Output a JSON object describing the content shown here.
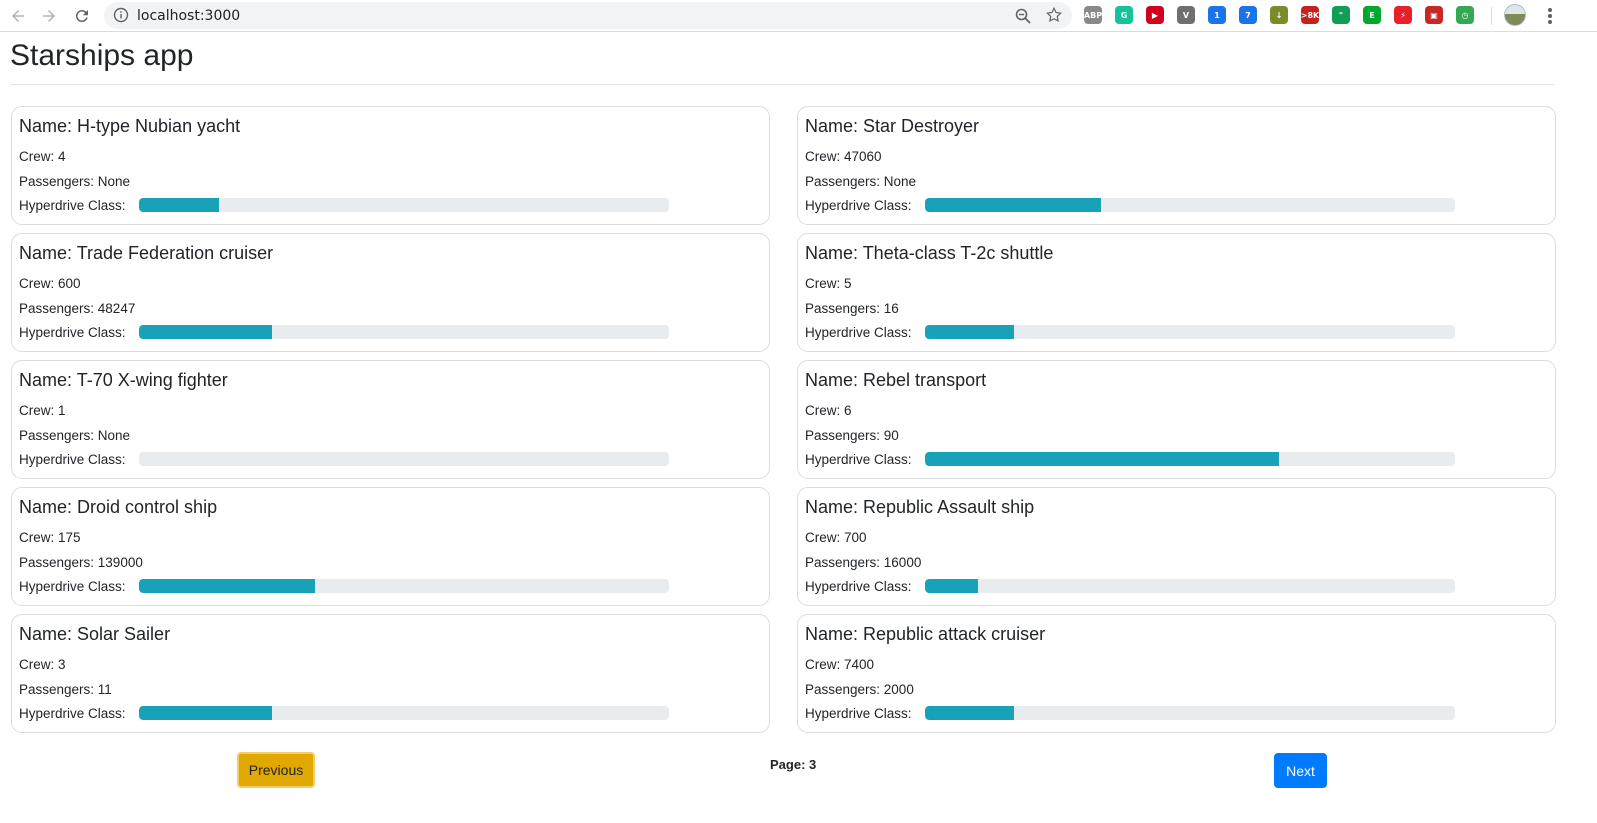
{
  "browser": {
    "url": "localhost:3000",
    "extensions": [
      {
        "icon": "adblock-plus-icon",
        "color": "#8a8a8a",
        "label": "ABP"
      },
      {
        "icon": "grammarly-icon",
        "color": "#15c39a",
        "label": "G"
      },
      {
        "icon": "video-downloader-icon",
        "color": "#d0021b",
        "label": "▶"
      },
      {
        "icon": "vimium-icon",
        "color": "#6f6f6f",
        "label": "V"
      },
      {
        "icon": "calendar-icon",
        "color": "#1a73e8",
        "label": "1"
      },
      {
        "icon": "mail-checker-icon",
        "color": "#1a73e8",
        "label": "7"
      },
      {
        "icon": "download-icon",
        "color": "#7a8b2a",
        "label": "↓"
      },
      {
        "icon": "gmail-notifier-icon",
        "color": "#c5221f",
        "label": ">8K"
      },
      {
        "icon": "hangouts-icon",
        "color": "#0f9d58",
        "label": "\""
      },
      {
        "icon": "evernote-icon",
        "color": "#00a82d",
        "label": "E"
      },
      {
        "icon": "compass-icon",
        "color": "#e8202a",
        "label": "⚡"
      },
      {
        "icon": "photo-icon",
        "color": "#c62828",
        "label": "▣"
      },
      {
        "icon": "timer-icon",
        "color": "#34a853",
        "label": "◷"
      }
    ]
  },
  "page": {
    "title": "Starships app"
  },
  "ships": [
    {
      "name": "Name: H-type Nubian yacht",
      "crew": "Crew: 4",
      "passengers": "Passengers: None",
      "hyperdrive_label": "Hyperdrive Class:",
      "hyperdrive_percent": 15
    },
    {
      "name": "Name: Star Destroyer",
      "crew": "Crew: 47060",
      "passengers": "Passengers: None",
      "hyperdrive_label": "Hyperdrive Class:",
      "hyperdrive_percent": 33.3
    },
    {
      "name": "Name: Trade Federation cruiser",
      "crew": "Crew: 600",
      "passengers": "Passengers: 48247",
      "hyperdrive_label": "Hyperdrive Class:",
      "hyperdrive_percent": 25
    },
    {
      "name": "Name: Theta-class T-2c shuttle",
      "crew": "Crew: 5",
      "passengers": "Passengers: 16",
      "hyperdrive_label": "Hyperdrive Class:",
      "hyperdrive_percent": 16.7
    },
    {
      "name": "Name: T-70 X-wing fighter",
      "crew": "Crew: 1",
      "passengers": "Passengers: None",
      "hyperdrive_label": "Hyperdrive Class:",
      "hyperdrive_percent": 0
    },
    {
      "name": "Name: Rebel transport",
      "crew": "Crew: 6",
      "passengers": "Passengers: 90",
      "hyperdrive_label": "Hyperdrive Class:",
      "hyperdrive_percent": 66.7
    },
    {
      "name": "Name: Droid control ship",
      "crew": "Crew: 175",
      "passengers": "Passengers: 139000",
      "hyperdrive_label": "Hyperdrive Class:",
      "hyperdrive_percent": 33.3
    },
    {
      "name": "Name: Republic Assault ship",
      "crew": "Crew: 700",
      "passengers": "Passengers: 16000",
      "hyperdrive_label": "Hyperdrive Class:",
      "hyperdrive_percent": 10
    },
    {
      "name": "Name: Solar Sailer",
      "crew": "Crew: 3",
      "passengers": "Passengers: 11",
      "hyperdrive_label": "Hyperdrive Class:",
      "hyperdrive_percent": 25
    },
    {
      "name": "Name: Republic attack cruiser",
      "crew": "Crew: 7400",
      "passengers": "Passengers: 2000",
      "hyperdrive_label": "Hyperdrive Class:",
      "hyperdrive_percent": 16.7
    }
  ],
  "pagination": {
    "previous_label": "Previous",
    "page_label": "Page: 3",
    "next_label": "Next"
  },
  "colors": {
    "progress_fill": "#17a2b8",
    "progress_track": "#e9ecef",
    "previous_button": "#e0a800",
    "next_button": "#007bff"
  }
}
